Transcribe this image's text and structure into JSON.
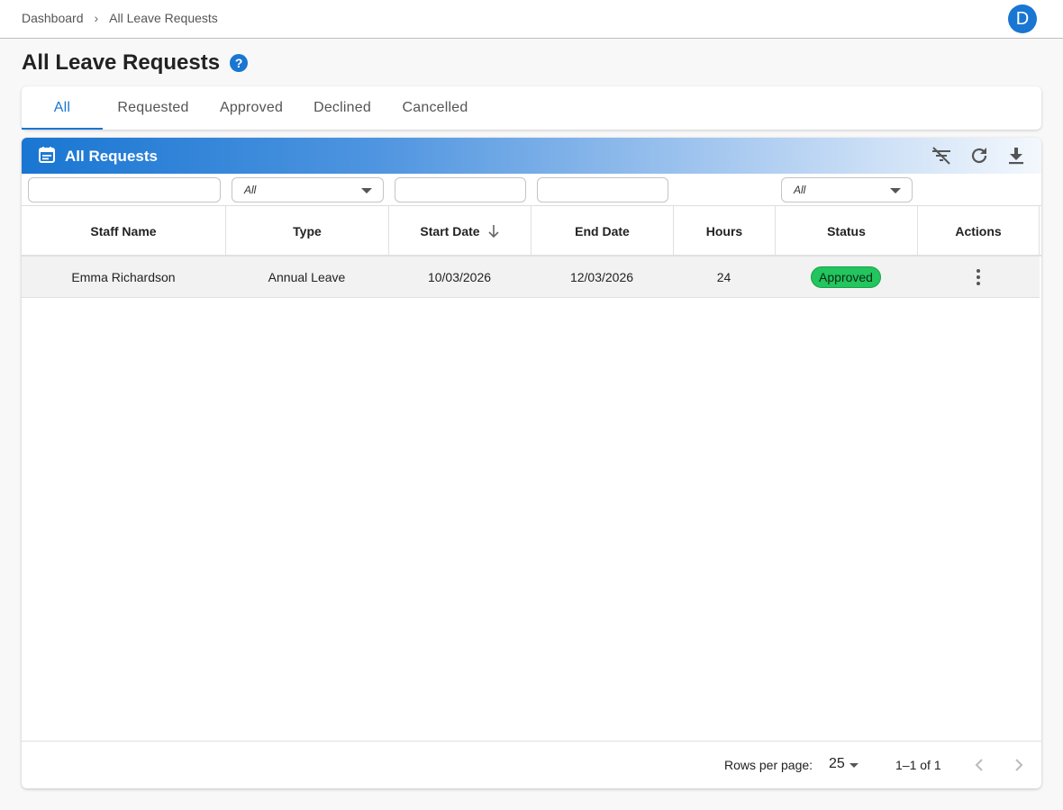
{
  "breadcrumb": {
    "home": "Dashboard",
    "current": "All Leave Requests"
  },
  "avatar": {
    "initial": "D",
    "color": "#1976d2"
  },
  "page": {
    "title": "All Leave Requests",
    "help": "?"
  },
  "tabs": [
    {
      "label": "All",
      "active": true
    },
    {
      "label": "Requested",
      "active": false
    },
    {
      "label": "Approved",
      "active": false
    },
    {
      "label": "Declined",
      "active": false
    },
    {
      "label": "Cancelled",
      "active": false
    }
  ],
  "card": {
    "title": "All Requests",
    "icons": [
      "calendar-icon",
      "clear-filter-icon",
      "refresh-icon",
      "download-icon"
    ]
  },
  "filters": {
    "staff_name": "",
    "type": "All",
    "start_date": "",
    "end_date": "",
    "status": "All"
  },
  "table": {
    "columns": [
      "Staff Name",
      "Type",
      "Start Date",
      "End Date",
      "Hours",
      "Status",
      "Actions"
    ],
    "sorted_column": "Start Date",
    "sort_direction": "descending",
    "rows": [
      {
        "staff_name": "Emma Richardson",
        "type": "Annual Leave",
        "start_date": "10/03/2026",
        "end_date": "12/03/2026",
        "hours": "24",
        "status": "Approved"
      }
    ]
  },
  "pagination": {
    "rows_per_page_label": "Rows per page:",
    "rows_per_page": "25",
    "range": "1–1 of 1"
  },
  "colors": {
    "accent": "#1976d2",
    "approved": "#22c55e"
  }
}
